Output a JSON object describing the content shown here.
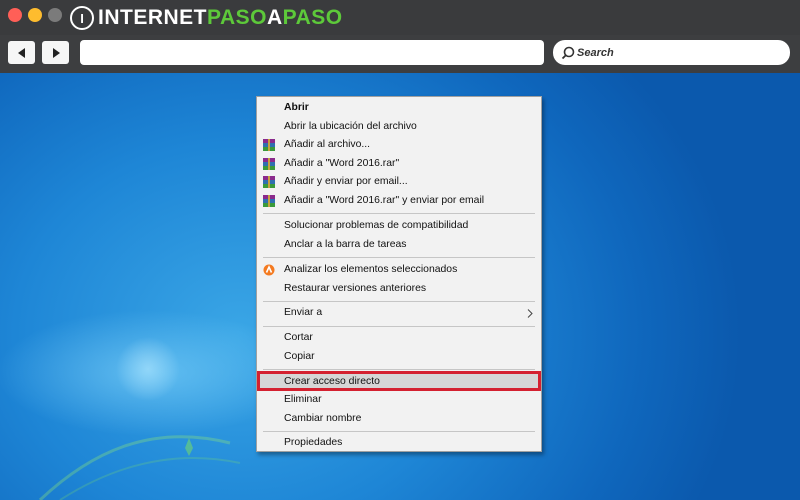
{
  "browser": {
    "brand_part1": "INTERNET",
    "brand_part2": "PASO",
    "brand_part3": "A",
    "brand_part4": "PASO",
    "logo_glyph": "I",
    "search_placeholder": "Search",
    "back_icon": "back-arrow",
    "forward_icon": "forward-arrow"
  },
  "colors": {
    "accent_green": "#5dc93a",
    "highlight_border": "#d42130",
    "desktop_blue": "#1e86d6"
  },
  "context_menu": {
    "items": [
      {
        "label": "Abrir",
        "bold": true,
        "icon": null
      },
      {
        "label": "Abrir la ubicación del archivo",
        "icon": null
      },
      {
        "label": "Añadir al archivo...",
        "icon": "winrar-icon"
      },
      {
        "label": "Añadir a \"Word 2016.rar\"",
        "icon": "winrar-icon"
      },
      {
        "label": "Añadir y enviar por email...",
        "icon": "winrar-icon"
      },
      {
        "label": "Añadir a \"Word 2016.rar\" y enviar por email",
        "icon": "winrar-icon"
      },
      {
        "label": "Solucionar problemas de compatibilidad",
        "icon": null
      },
      {
        "label": "Anclar a la barra de tareas",
        "icon": null
      },
      {
        "label": "Analizar los elementos seleccionados",
        "icon": "avast-icon"
      },
      {
        "label": "Restaurar versiones anteriores",
        "icon": null
      },
      {
        "label": "Enviar a",
        "icon": null,
        "submenu": true
      },
      {
        "label": "Cortar",
        "icon": null
      },
      {
        "label": "Copiar",
        "icon": null
      },
      {
        "label": "Crear acceso directo",
        "icon": null,
        "highlighted": true
      },
      {
        "label": "Eliminar",
        "icon": null
      },
      {
        "label": "Cambiar nombre",
        "icon": null
      },
      {
        "label": "Propiedades",
        "icon": null
      }
    ]
  }
}
